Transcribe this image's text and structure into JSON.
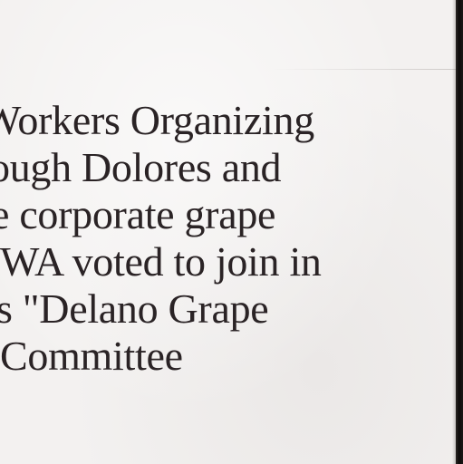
{
  "document": {
    "lines": [
      "Workers Organizing",
      "ough Dolores and",
      "e corporate grape",
      "WA voted to join in",
      "s \"Delano Grape",
      "Committee"
    ]
  }
}
